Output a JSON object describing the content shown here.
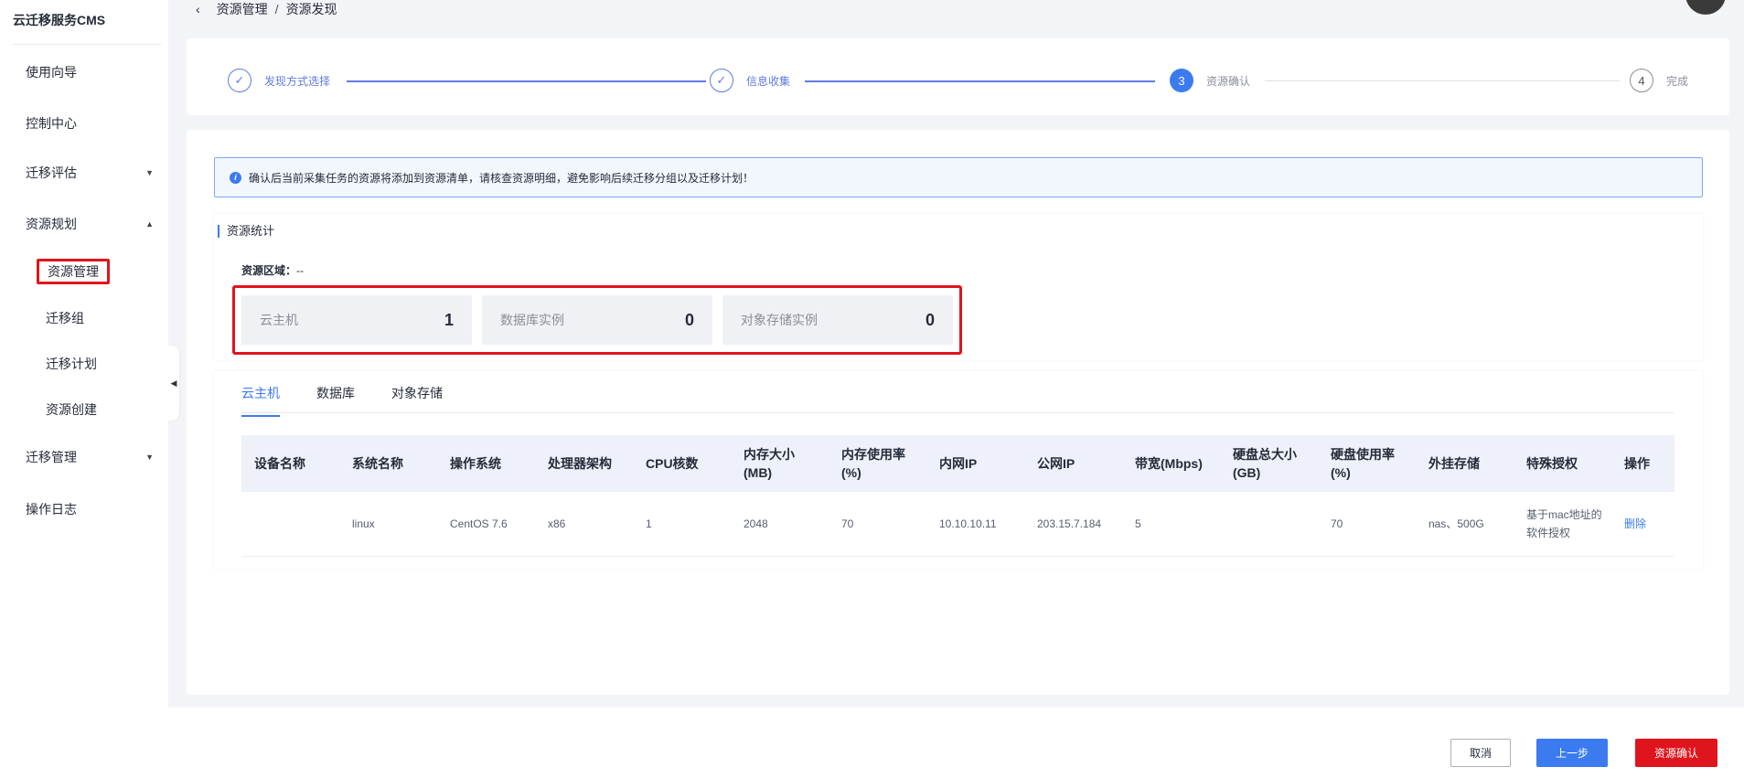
{
  "app": {
    "title": "云迁移服务CMS"
  },
  "sidebar": {
    "items": [
      {
        "label": "使用向导"
      },
      {
        "label": "控制中心"
      },
      {
        "label": "迁移评估",
        "caret": "▼"
      },
      {
        "label": "资源规划",
        "caret": "▲"
      },
      {
        "label": "迁移管理",
        "caret": "▼"
      },
      {
        "label": "操作日志"
      }
    ],
    "sub_items": [
      {
        "label": "资源管理",
        "active": true
      },
      {
        "label": "迁移组"
      },
      {
        "label": "迁移计划"
      },
      {
        "label": "资源创建"
      }
    ],
    "collapse_glyph": "◀"
  },
  "breadcrumb": {
    "back_glyph": "‹",
    "parent": "资源管理",
    "separator": "/",
    "current": "资源发现"
  },
  "steps": [
    {
      "label": "发现方式选择",
      "marker": "✓",
      "state": "done"
    },
    {
      "label": "信息收集",
      "marker": "✓",
      "state": "done"
    },
    {
      "label": "资源确认",
      "marker": "3",
      "state": "current"
    },
    {
      "label": "完成",
      "marker": "4",
      "state": "todo"
    }
  ],
  "notice": {
    "icon_glyph": "i",
    "text": "确认后当前采集任务的资源将添加到资源清单，请核查资源明细，避免影响后续迁移分组以及迁移计划！"
  },
  "stats": {
    "title": "资源统计",
    "region_label": "资源区域：",
    "region_value": "--",
    "boxes": [
      {
        "label": "云主机",
        "value": "1"
      },
      {
        "label": "数据库实例",
        "value": "0"
      },
      {
        "label": "对象存储实例",
        "value": "0"
      }
    ]
  },
  "tabs": [
    {
      "label": "云主机",
      "active": true
    },
    {
      "label": "数据库"
    },
    {
      "label": "对象存储"
    }
  ],
  "table": {
    "headers": [
      "设备名称",
      "系统名称",
      "操作系统",
      "处理器架构",
      "CPU核数",
      "内存大小(MB)",
      "内存使用率(%)",
      "内网IP",
      "公网IP",
      "带宽(Mbps)",
      "硬盘总大小(GB)",
      "硬盘使用率(%)",
      "外挂存储",
      "特殊授权",
      "操作"
    ],
    "rows": [
      [
        "",
        "linux",
        "CentOS 7.6",
        "x86",
        "1",
        "2048",
        "70",
        "10.10.10.11",
        "203.15.7.184",
        "5",
        "",
        "70",
        "nas、500G",
        "基于mac地址的软件授权",
        "删除"
      ]
    ]
  },
  "footer": {
    "cancel": "取消",
    "prev": "上一步",
    "confirm": "资源确认"
  },
  "colors": {
    "accent": "#3b7bef",
    "danger": "#e0141d",
    "step_done": "#5e7ce0"
  }
}
